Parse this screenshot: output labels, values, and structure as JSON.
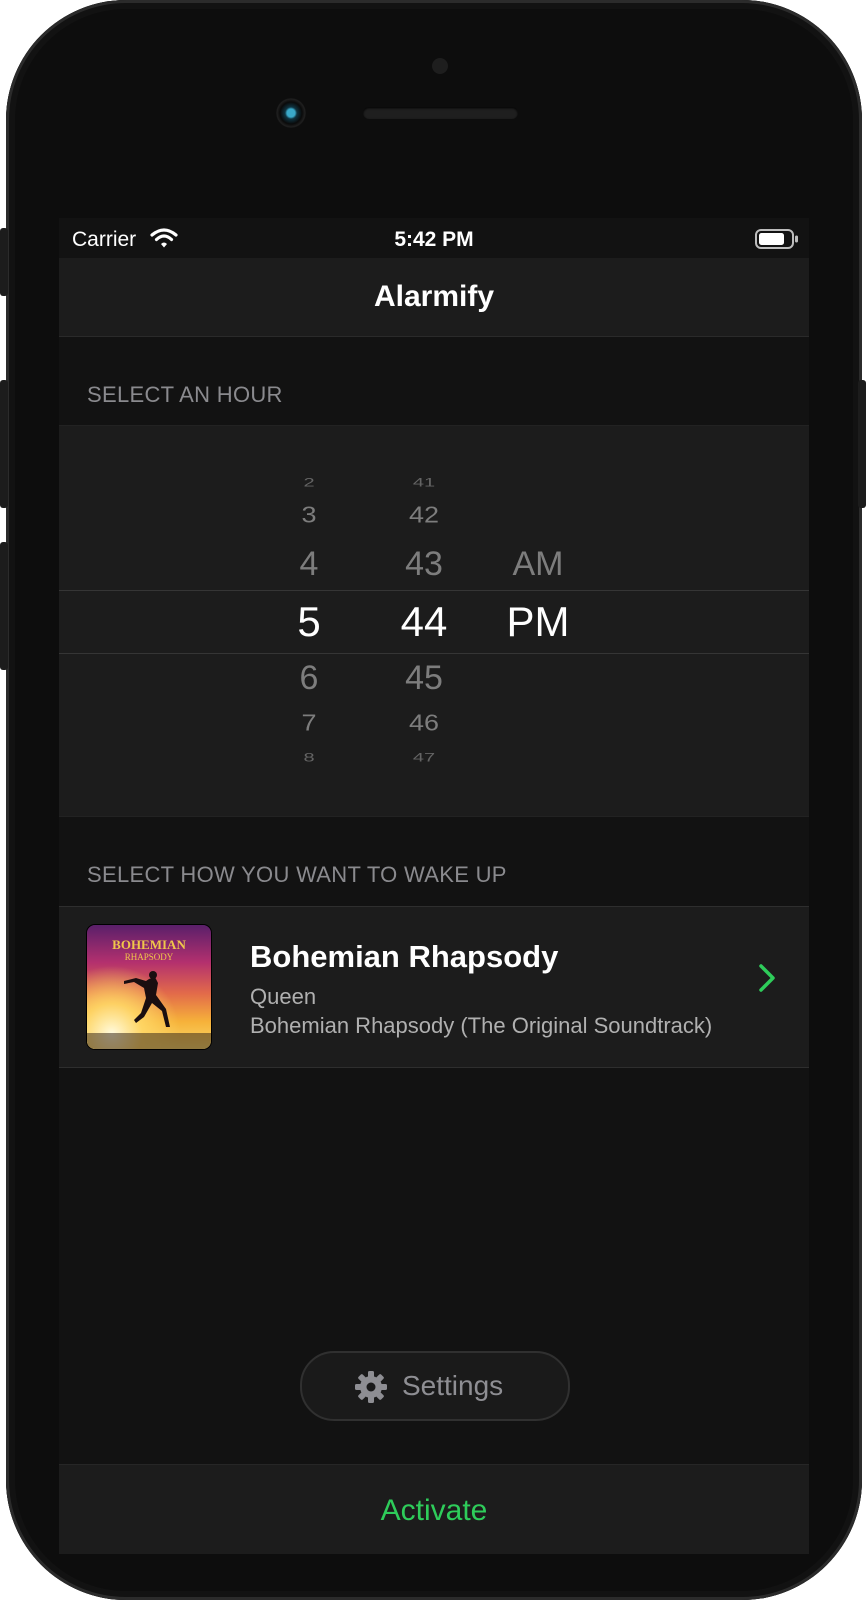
{
  "status_bar": {
    "carrier": "Carrier",
    "time": "5:42 PM"
  },
  "nav": {
    "title": "Alarmify"
  },
  "hour_section": {
    "header": "SELECT AN HOUR"
  },
  "time_picker": {
    "hours": [
      "2",
      "3",
      "4",
      "5",
      "6",
      "7",
      "8"
    ],
    "minutes": [
      "41",
      "42",
      "43",
      "44",
      "45",
      "46",
      "47"
    ],
    "periods": [
      "AM",
      "PM"
    ],
    "selected": {
      "hour": "5",
      "minute": "44",
      "period": "PM"
    }
  },
  "wake_section": {
    "header": "SELECT HOW YOU WANT TO WAKE UP"
  },
  "song": {
    "title": "Bohemian Rhapsody",
    "artist": "Queen",
    "album": "Bohemian Rhapsody (The Original Soundtrack)",
    "art_text_line1": "BOHEMIAN",
    "art_text_line2": "RHAPSODY"
  },
  "settings_button": {
    "label": "Settings",
    "icon": "gear-icon"
  },
  "activate_button": {
    "label": "Activate"
  },
  "colors": {
    "accent": "#2ecc5a",
    "background": "#121212",
    "surface": "#1c1c1c",
    "secondary_text": "#8a8a8e"
  }
}
